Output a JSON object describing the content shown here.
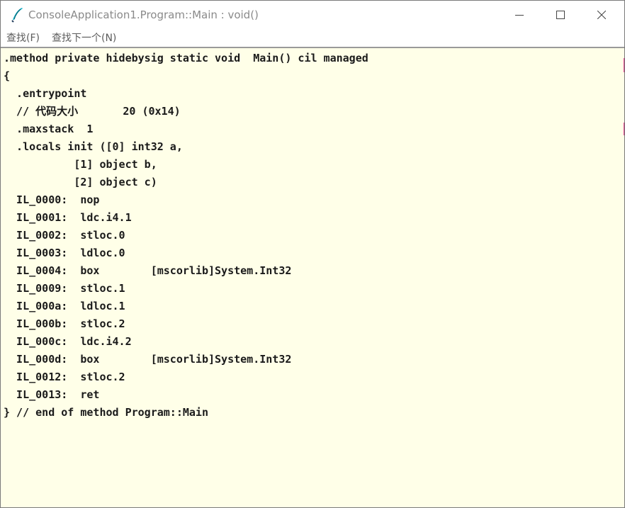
{
  "window": {
    "title": "ConsoleApplication1.Program::Main : void()",
    "icon": "quill-icon",
    "controls": {
      "minimize": "minimize-icon",
      "maximize": "maximize-icon",
      "close": "close-icon"
    }
  },
  "menu": {
    "find": "查找(F)",
    "find_next": "查找下一个(N)"
  },
  "colors": {
    "code_background": "#ffffe8",
    "code_text": "#1a1a1a",
    "title_text": "#8a8a8a",
    "menu_text": "#5c5c5c",
    "edge_accent": "#e23d8f"
  },
  "code_lines": [
    ".method private hidebysig static void  Main() cil managed",
    "{",
    "  .entrypoint",
    "  // 代码大小       20 (0x14)",
    "  .maxstack  1",
    "  .locals init ([0] int32 a,",
    "           [1] object b,",
    "           [2] object c)",
    "  IL_0000:  nop",
    "  IL_0001:  ldc.i4.1",
    "  IL_0002:  stloc.0",
    "  IL_0003:  ldloc.0",
    "  IL_0004:  box        [mscorlib]System.Int32",
    "  IL_0009:  stloc.1",
    "  IL_000a:  ldloc.1",
    "  IL_000b:  stloc.2",
    "  IL_000c:  ldc.i4.2",
    "  IL_000d:  box        [mscorlib]System.Int32",
    "  IL_0012:  stloc.2",
    "  IL_0013:  ret",
    "} // end of method Program::Main"
  ]
}
